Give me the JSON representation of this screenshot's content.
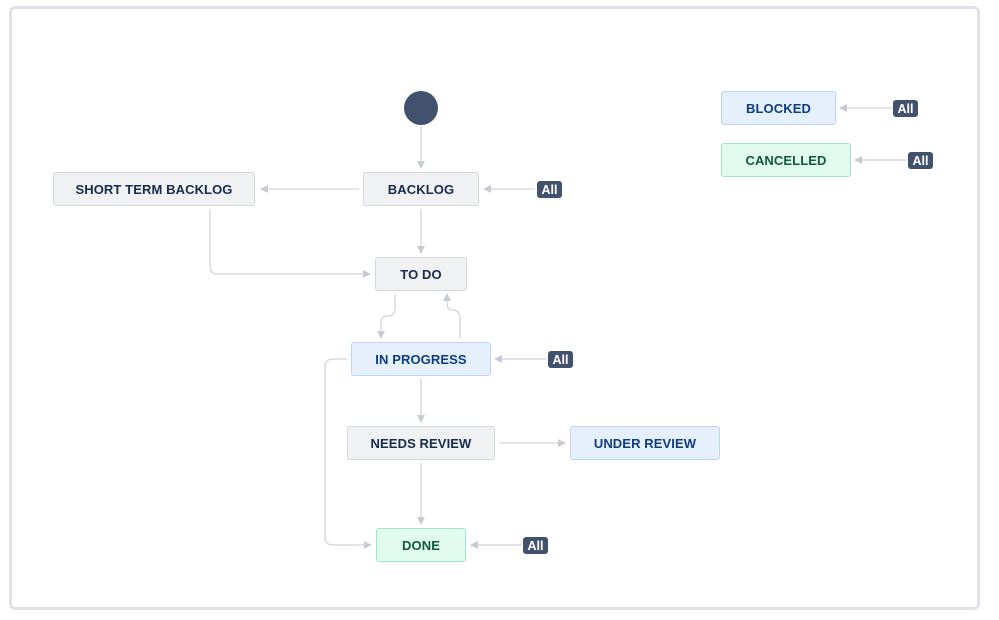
{
  "diagram": {
    "statuses": {
      "backlog": "BACKLOG",
      "short_term_backlog": "SHORT TERM BACKLOG",
      "to_do": "TO DO",
      "in_progress": "IN PROGRESS",
      "needs_review": "NEEDS REVIEW",
      "under_review": "UNDER REVIEW",
      "done": "DONE",
      "blocked": "BLOCKED",
      "cancelled": "CANCELLED"
    },
    "all_label": "All",
    "colors": {
      "todo_category_bg": "#f0f1f3",
      "in_progress_category_bg": "#e6f0fd",
      "done_category_bg": "#e1fbef",
      "badge_bg": "#42526e",
      "arrow": "#c8cbd1"
    }
  }
}
